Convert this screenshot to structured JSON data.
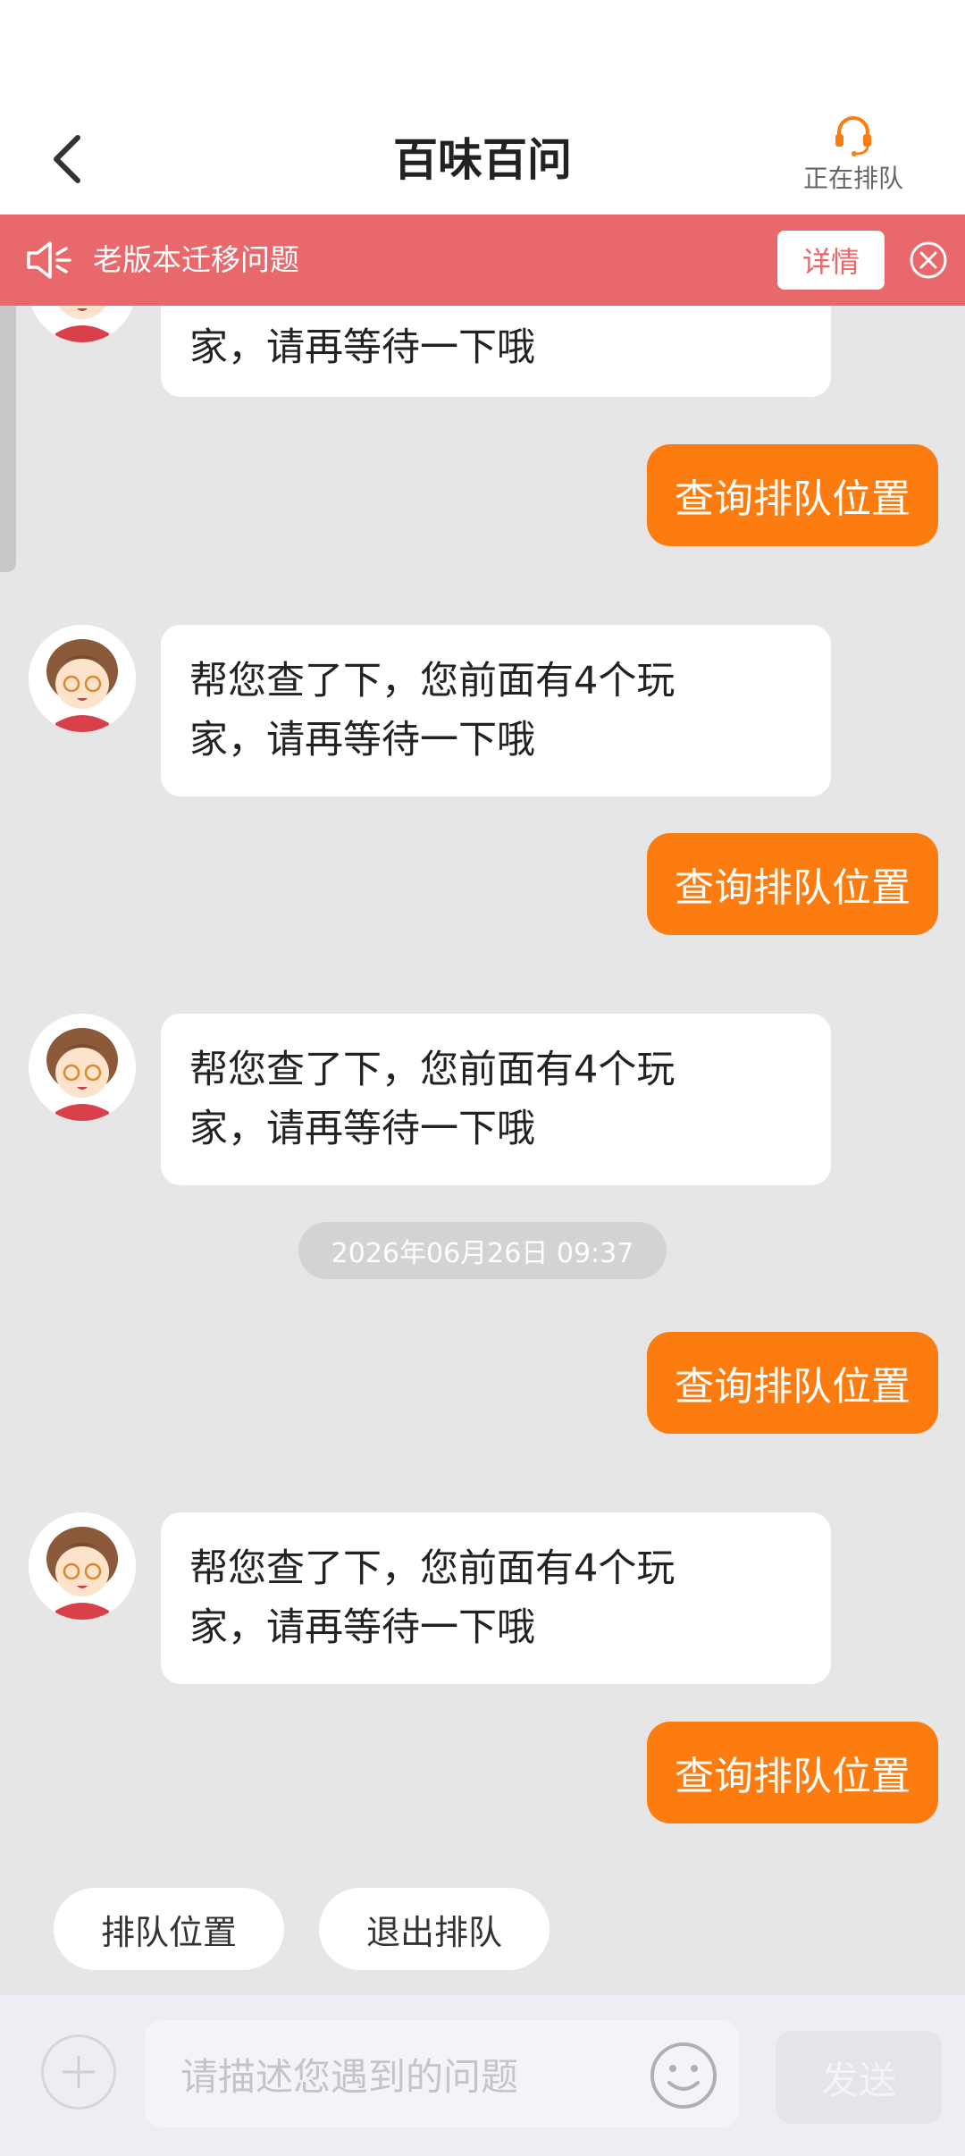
{
  "header": {
    "title": "百味百问",
    "queue_status_label": "正在排队"
  },
  "notice": {
    "text": "老版本迁移问题",
    "detail_label": "详情"
  },
  "messages": {
    "partial_bot_line": "家，请再等待一下哦",
    "bot_reply_line1": "帮您查了下，您前面有4个玩",
    "bot_reply_line2": "家，请再等待一下哦",
    "user_query": "查询排队位置",
    "timestamp": "2026年06月26日 09:37"
  },
  "quick_replies": [
    "排队位置",
    "退出排队"
  ],
  "composer": {
    "placeholder": "请描述您遇到的问题",
    "send_label": "发送"
  },
  "colors": {
    "accent_orange": "#fd7c10",
    "notice_red": "#e8686b",
    "chat_background": "#e6e6e6"
  }
}
